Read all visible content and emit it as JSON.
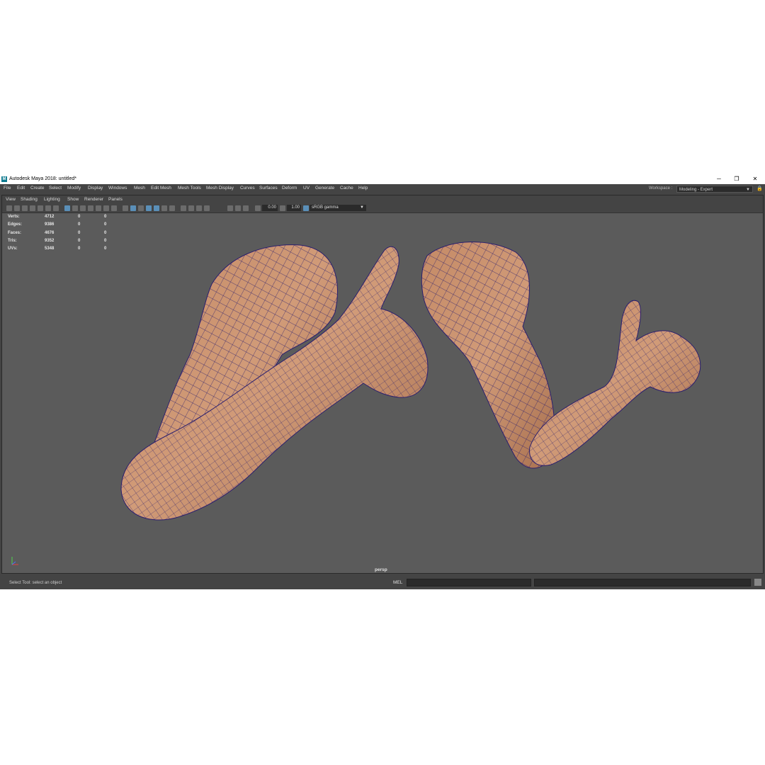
{
  "window": {
    "title": "Autodesk Maya 2018: untitled*",
    "logo": "M",
    "minimize_icon": "─",
    "restore_icon": "❐",
    "close_icon": "✕"
  },
  "menubar": {
    "items": [
      "File",
      "Edit",
      "Create",
      "Select",
      "Modify",
      "Display",
      "Windows",
      "Mesh",
      "Edit Mesh",
      "Mesh Tools",
      "Mesh Display",
      "Curves",
      "Surfaces",
      "Deform",
      "UV",
      "Generate",
      "Cache",
      "Help"
    ],
    "workspace_label": "Workspace :",
    "workspace_value": "Modeling - Expert"
  },
  "panel_menu": {
    "items": [
      "View",
      "Shading",
      "Lighting",
      "Show",
      "Renderer",
      "Panels"
    ]
  },
  "toolbar": {
    "exposure": "0.00",
    "gamma": "1.00",
    "color_space": "sRGB gamma"
  },
  "hud": {
    "rows": [
      {
        "label": "Verts:",
        "a": "4712",
        "b": "0",
        "c": "0"
      },
      {
        "label": "Edges:",
        "a": "9386",
        "b": "0",
        "c": "0"
      },
      {
        "label": "Faces:",
        "a": "4676",
        "b": "0",
        "c": "0"
      },
      {
        "label": "Tris:",
        "a": "9352",
        "b": "0",
        "c": "0"
      },
      {
        "label": "UVs:",
        "a": "5348",
        "b": "0",
        "c": "0"
      }
    ]
  },
  "viewport": {
    "camera_label": "persp",
    "background_color": "#5b5b5b",
    "skin_color": "#c58c6c",
    "wire_color": "#2b1f6e"
  },
  "command_line": {
    "help_text": "Select Tool: select an object",
    "language": "MEL"
  },
  "icons": [
    "camera-icon",
    "grid-icon",
    "wireframe-icon",
    "shaded-icon",
    "light-icon",
    "script-editor-icon"
  ]
}
